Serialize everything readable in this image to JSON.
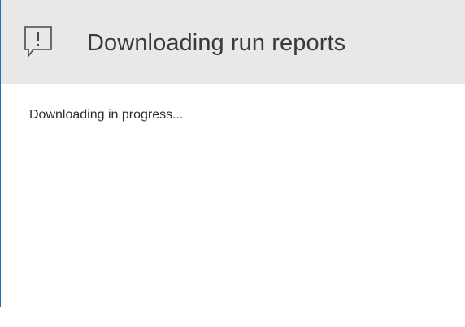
{
  "dialog": {
    "title": "Downloading run reports",
    "icon": "alert-speech-bubble-icon",
    "message": "Downloading in progress..."
  },
  "colors": {
    "header_background": "#e8e8e8",
    "edge_accent": "#1e6fb8",
    "title_text": "#3a3a3a",
    "body_text": "#2e2e2e"
  }
}
